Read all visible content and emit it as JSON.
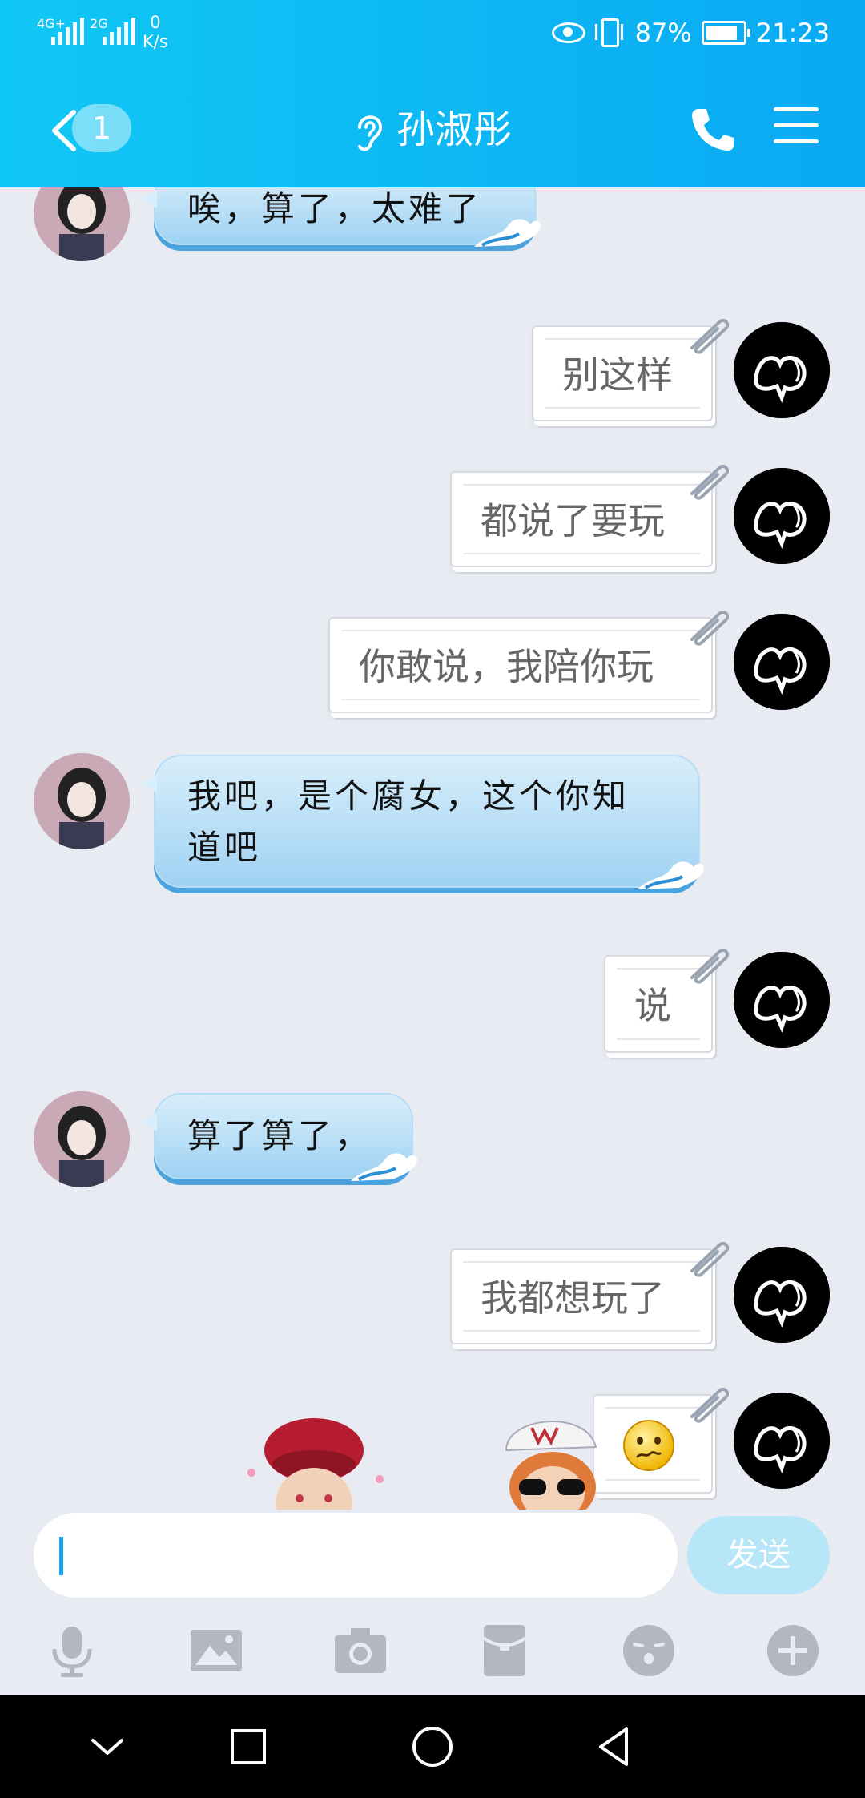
{
  "status_bar": {
    "network1": "4G+",
    "network2": "2G",
    "speed_value": "0",
    "speed_unit": "K/s",
    "battery": "87%",
    "battery_level": 0.87,
    "time": "21:23"
  },
  "header": {
    "unread_count": "1",
    "title": "孙淑彤",
    "bg_from": "#10c8f5",
    "bg_to": "#0aa9f3"
  },
  "messages": [
    {
      "side": "in",
      "text": "唉，算了，太难了"
    },
    {
      "side": "out",
      "text": "别这样"
    },
    {
      "side": "out",
      "text": "都说了要玩"
    },
    {
      "side": "out",
      "text": "你敢说，我陪你玩"
    },
    {
      "side": "in",
      "text": "我吧，是个腐女，这个你知道吧",
      "line1": "我吧，是个腐女，这个你知",
      "line2": "道吧"
    },
    {
      "side": "out",
      "text": "说"
    },
    {
      "side": "in",
      "text": "算了算了，"
    },
    {
      "side": "out",
      "text": "我都想玩了"
    },
    {
      "side": "out",
      "emoji": "confused-face"
    }
  ],
  "composer": {
    "input_value": "",
    "send_label": "发送"
  },
  "toolbar": {
    "icons": [
      "microphone-icon",
      "image-icon",
      "camera-icon",
      "red-packet-icon",
      "sticker-icon",
      "plus-icon"
    ]
  },
  "colors": {
    "accent": "#1aa3f0",
    "send_disabled": "#b8e6f9",
    "chat_bg": "#e9ebf3"
  }
}
